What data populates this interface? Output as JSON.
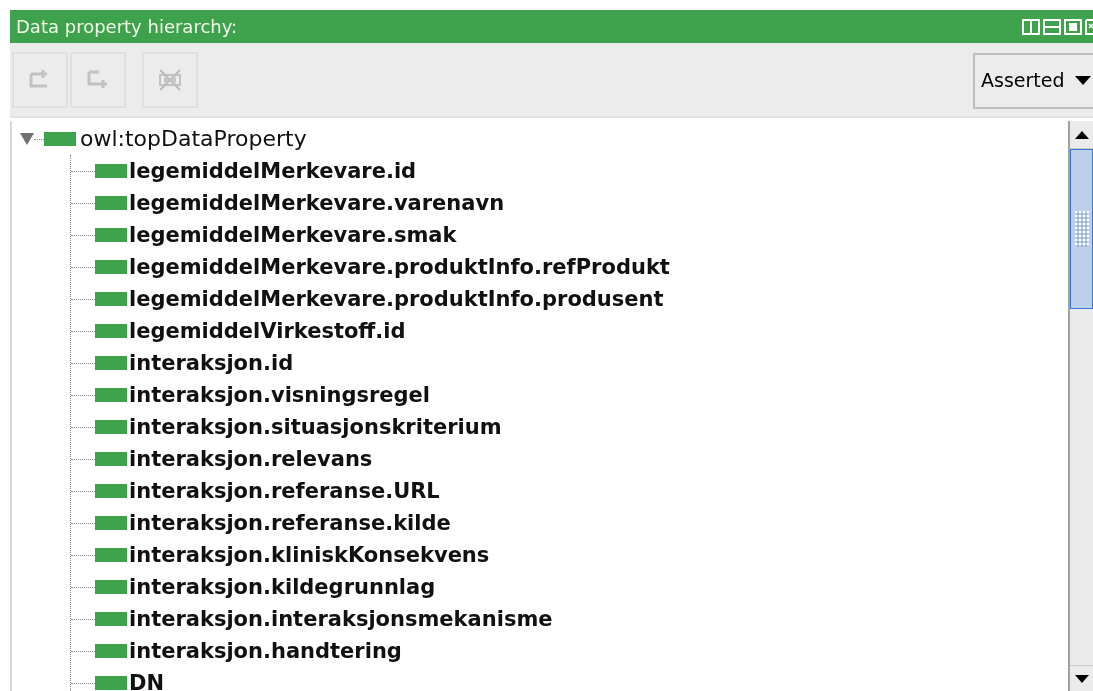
{
  "panel": {
    "title": "Data property hierarchy:"
  },
  "toolbar": {
    "buttons": [
      {
        "kind": "add-sub",
        "disabled": true
      },
      {
        "kind": "add-sibling",
        "disabled": true
      },
      {
        "kind": "delete",
        "disabled": true
      }
    ],
    "view_select": {
      "value": "Asserted"
    }
  },
  "tree": [
    {
      "label": "owl:topDataProperty",
      "expanded": true,
      "children": [
        {
          "label": "legemiddelMerkevare.id"
        },
        {
          "label": "legemiddelMerkevare.varenavn"
        },
        {
          "label": "legemiddelMerkevare.smak"
        },
        {
          "label": "legemiddelMerkevare.produktInfo.refProdukt"
        },
        {
          "label": "legemiddelMerkevare.produktInfo.produsent"
        },
        {
          "label": "legemiddelVirkestoff.id"
        },
        {
          "label": "interaksjon.id"
        },
        {
          "label": "interaksjon.visningsregel"
        },
        {
          "label": "interaksjon.situasjonskriterium"
        },
        {
          "label": "interaksjon.relevans"
        },
        {
          "label": "interaksjon.referanse.URL"
        },
        {
          "label": "interaksjon.referanse.kilde"
        },
        {
          "label": "interaksjon.kliniskKonsekvens"
        },
        {
          "label": "interaksjon.kildegrunnlag"
        },
        {
          "label": "interaksjon.interaksjonsmekanisme"
        },
        {
          "label": "interaksjon.handtering"
        },
        {
          "label": "DN"
        }
      ]
    }
  ]
}
